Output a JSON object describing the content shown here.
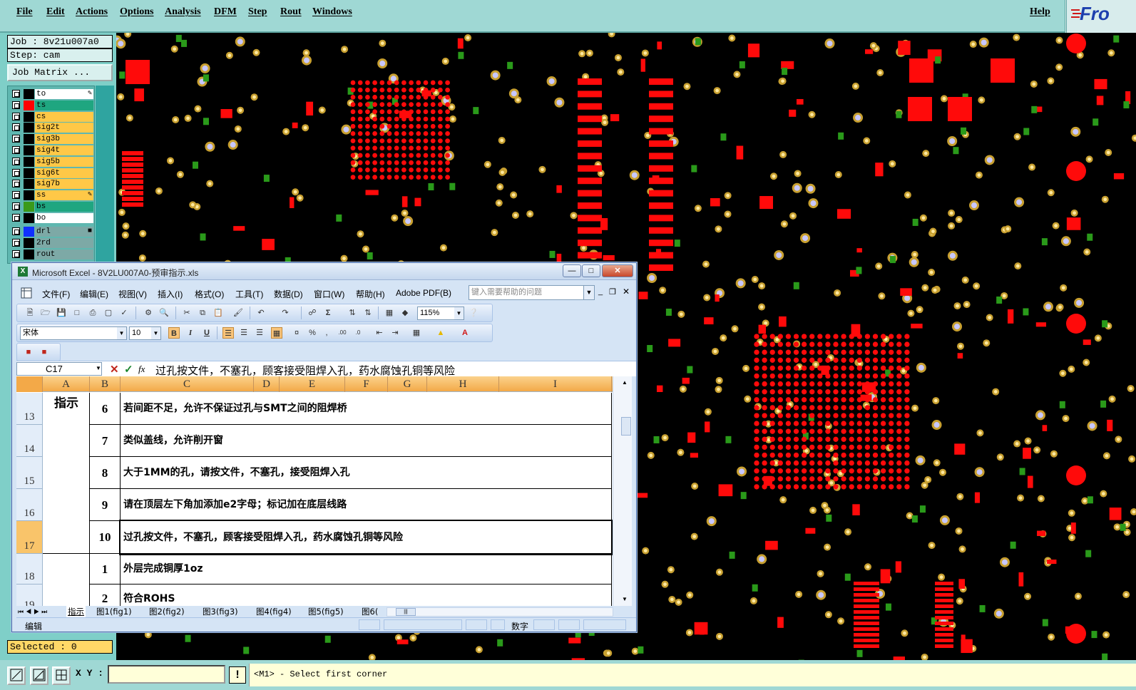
{
  "cam": {
    "menu": [
      "File",
      "Edit",
      "Actions",
      "Options",
      "Analysis",
      "DFM",
      "Step",
      "Rout",
      "Windows"
    ],
    "help_label": "Help",
    "logo_text": "Fro",
    "job": "Job : 8v21u007a0",
    "step": "Step: cam",
    "job_matrix_button": "Job Matrix ...",
    "layers": [
      {
        "name": "to",
        "color": "#000000",
        "bg": "#ffffff",
        "edit": "✎"
      },
      {
        "name": "ts",
        "color": "#ff0000",
        "bg": "#1fa680",
        "edit": ""
      },
      {
        "name": "cs",
        "color": "#000000",
        "bg": "#ffc847",
        "edit": ""
      },
      {
        "name": "sig2t",
        "color": "#000000",
        "bg": "#ffc847",
        "edit": ""
      },
      {
        "name": "sig3b",
        "color": "#000000",
        "bg": "#ffc847",
        "edit": ""
      },
      {
        "name": "sig4t",
        "color": "#000000",
        "bg": "#ffc847",
        "edit": ""
      },
      {
        "name": "sig5b",
        "color": "#000000",
        "bg": "#ffc847",
        "edit": ""
      },
      {
        "name": "sig6t",
        "color": "#000000",
        "bg": "#ffc847",
        "edit": ""
      },
      {
        "name": "sig7b",
        "color": "#000000",
        "bg": "#ffc847",
        "edit": ""
      },
      {
        "name": "ss",
        "color": "#000000",
        "bg": "#ffc847",
        "edit": "✎"
      },
      {
        "name": "bs",
        "color": "#3a9a1a",
        "bg": "#1fa680",
        "edit": ""
      },
      {
        "name": "bo",
        "color": "#000000",
        "bg": "#ffffff",
        "edit": ""
      }
    ],
    "drill_layers": [
      {
        "name": "drl",
        "color": "#1030ff",
        "bg": "#7da9a6",
        "edit": "■"
      },
      {
        "name": "2rd",
        "color": "#000000",
        "bg": "#7da9a6",
        "edit": ""
      },
      {
        "name": "rout",
        "color": "#000000",
        "bg": "#7da9a6",
        "edit": ""
      }
    ],
    "selected": "Selected : 0",
    "xy_label": "X Y :",
    "xy_value": "",
    "message": "<M1> - Select first corner"
  },
  "excel": {
    "title": "Microsoft Excel - 8V2LU007A0-预审指示.xls",
    "menu": [
      "文件(F)",
      "编辑(E)",
      "视图(V)",
      "插入(I)",
      "格式(O)",
      "工具(T)",
      "数据(D)",
      "窗口(W)",
      "帮助(H)",
      "Adobe PDF(B)"
    ],
    "help_placeholder": "键入需要帮助的问题",
    "zoom": "115%",
    "font_name": "宋体",
    "font_size": "10",
    "name_box": "C17",
    "formula": "过孔按文件，不塞孔，顾客接受阻焊入孔，药水腐蚀孔铜等风险",
    "columns": [
      "A",
      "B",
      "C",
      "D",
      "E",
      "F",
      "G",
      "H",
      "I"
    ],
    "group_label": "指示",
    "rows": [
      {
        "row": "13",
        "num": "6",
        "text": "若间距不足，允许不保证过孔与SMT之间的阻焊桥"
      },
      {
        "row": "14",
        "num": "7",
        "text": "类似盖线，允许削开窗"
      },
      {
        "row": "15",
        "num": "8",
        "text": "大于1MM的孔，请按文件，不塞孔，接受阻焊入孔"
      },
      {
        "row": "16",
        "num": "9",
        "text": "请在顶层左下角加添加e2字母；标记加在底层线路"
      },
      {
        "row": "17",
        "num": "10",
        "text": "过孔按文件，不塞孔，顾客接受阻焊入孔，药水腐蚀孔铜等风险"
      },
      {
        "row": "18",
        "num": "1",
        "text": "外层完成铜厚1oz"
      },
      {
        "row": "19",
        "num": "2",
        "text": "符合ROHS"
      }
    ],
    "sheet_tabs": [
      "指示",
      "图1(fig1)",
      "图2(fig2)",
      "图3(fig3)",
      "图4(fig4)",
      "图5(fig5)",
      "图6("
    ],
    "status_mode": "编辑",
    "status_num": "数字"
  }
}
